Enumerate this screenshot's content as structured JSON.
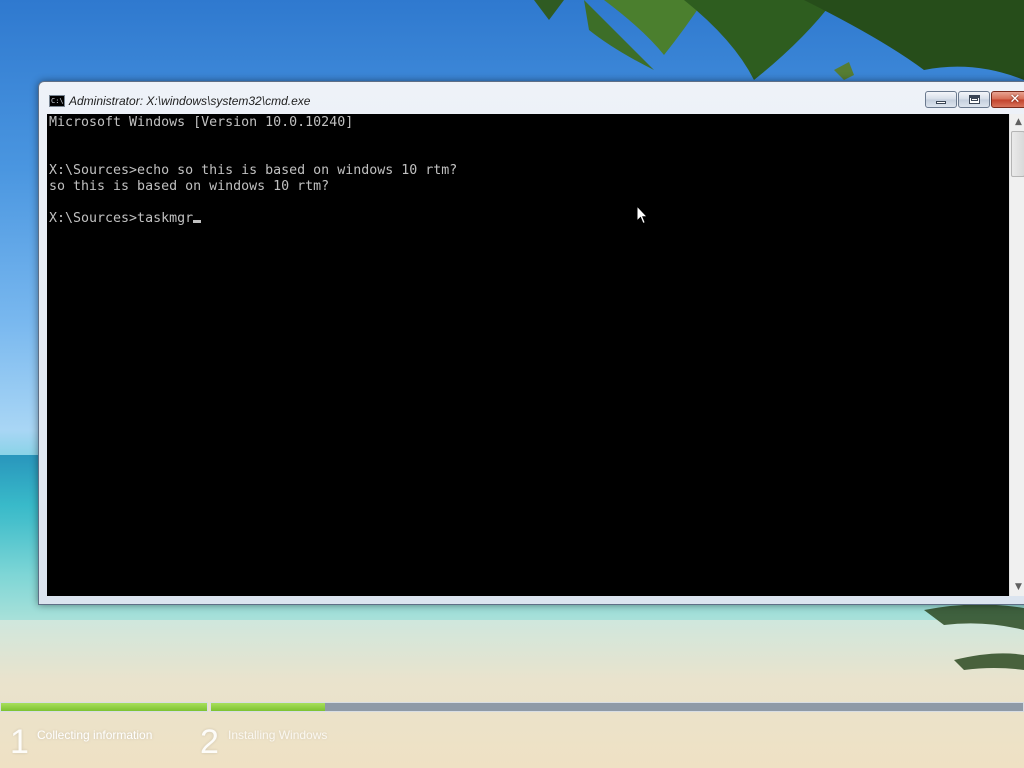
{
  "window": {
    "title": "Administrator: X:\\windows\\system32\\cmd.exe",
    "icon": "cmd-icon",
    "icon_text": "C:\\",
    "controls": {
      "minimize_icon": "minimize-icon",
      "maximize_icon": "maximize-icon",
      "close_icon": "close-icon",
      "close_glyph": "✕"
    }
  },
  "console": {
    "lines": [
      "Microsoft Windows [Version 10.0.10240]",
      "",
      "",
      "X:\\Sources>echo so this is based on windows 10 rtm?",
      "so this is based on windows 10 rtm?",
      "",
      "X:\\Sources>taskmgr"
    ],
    "colors": {
      "background": "#000000",
      "foreground": "#c0c0c0"
    }
  },
  "scrollbar": {
    "up_glyph": "▲",
    "down_glyph": "▼"
  },
  "setup_progress": {
    "steps": [
      {
        "number": "1",
        "label": "Collecting information",
        "progress": 1.0
      },
      {
        "number": "2",
        "label": "Installing Windows",
        "progress": 0.14
      }
    ],
    "accent": "#7dc232"
  }
}
